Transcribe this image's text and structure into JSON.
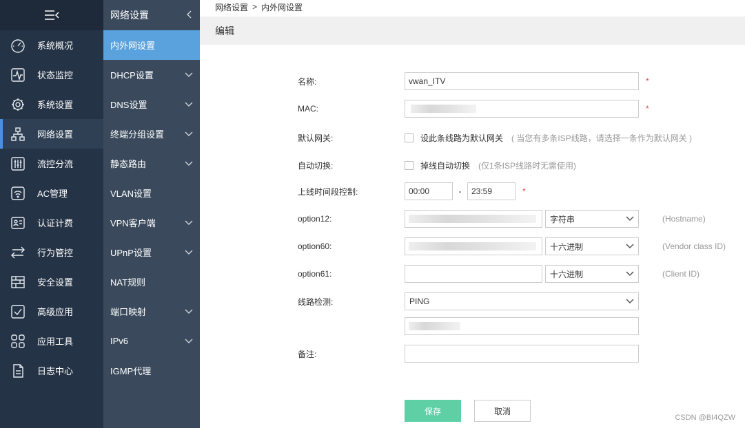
{
  "sidebar": {
    "items": [
      {
        "label": "系统概况",
        "icon": "gauge-icon"
      },
      {
        "label": "状态监控",
        "icon": "pulse-icon"
      },
      {
        "label": "系统设置",
        "icon": "gear-icon"
      },
      {
        "label": "网络设置",
        "icon": "network-icon"
      },
      {
        "label": "流控分流",
        "icon": "sliders-icon"
      },
      {
        "label": "AC管理",
        "icon": "wifi-icon"
      },
      {
        "label": "认证计费",
        "icon": "id-card-icon"
      },
      {
        "label": "行为管控",
        "icon": "arrows-icon"
      },
      {
        "label": "安全设置",
        "icon": "firewall-icon"
      },
      {
        "label": "高级应用",
        "icon": "check-box-icon"
      },
      {
        "label": "应用工具",
        "icon": "apps-icon"
      },
      {
        "label": "日志中心",
        "icon": "document-icon"
      }
    ],
    "active_index": 3
  },
  "subbar": {
    "title": "网络设置",
    "items": [
      {
        "label": "内外网设置",
        "expand": false
      },
      {
        "label": "DHCP设置",
        "expand": true
      },
      {
        "label": "DNS设置",
        "expand": true
      },
      {
        "label": "终端分组设置",
        "expand": true
      },
      {
        "label": "静态路由",
        "expand": true
      },
      {
        "label": "VLAN设置",
        "expand": false
      },
      {
        "label": "VPN客户端",
        "expand": true
      },
      {
        "label": "UPnP设置",
        "expand": true
      },
      {
        "label": "NAT规则",
        "expand": false
      },
      {
        "label": "端口映射",
        "expand": true
      },
      {
        "label": "IPv6",
        "expand": true
      },
      {
        "label": "IGMP代理",
        "expand": false
      }
    ]
  },
  "breadcrumb": {
    "parent": "网络设置",
    "separator": ">",
    "current": "内外网设置"
  },
  "edit_title": "编辑",
  "form": {
    "name": {
      "label": "名称:",
      "value": "vwan_ITV",
      "required": "*"
    },
    "mac": {
      "label": "MAC:",
      "value": "",
      "required": "*"
    },
    "gateway": {
      "label": "默认网关:",
      "checkbox_label": "设此条线路为默认网关",
      "hint": "( 当您有多条ISP线路，请选择一条作为默认网关 )"
    },
    "auto_switch": {
      "label": "自动切换:",
      "checkbox_label": "掉线自动切换",
      "hint": "(仅1条ISP线路时无需使用)"
    },
    "online_time": {
      "label": "上线时间段控制:",
      "start": "00:00",
      "dash": "-",
      "end": "23:59",
      "required": "*"
    },
    "option12": {
      "label": "option12:",
      "value": "",
      "type": "字符串",
      "hint": "(Hostname)"
    },
    "option60": {
      "label": "option60:",
      "value": "",
      "type": "十六进制",
      "hint": "(Vendor class ID)"
    },
    "option61": {
      "label": "option61:",
      "value": "",
      "type": "十六进制",
      "hint": "(Client ID)"
    },
    "line_check": {
      "label": "线路检测:",
      "method": "PING",
      "target": ""
    },
    "remark": {
      "label": "备注:",
      "value": ""
    }
  },
  "buttons": {
    "save": "保存",
    "cancel": "取消"
  },
  "watermark": "CSDN @BI4QZW"
}
